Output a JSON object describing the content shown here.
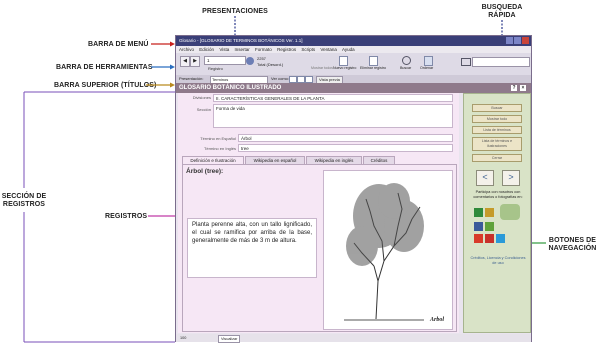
{
  "annotations": {
    "presentaciones": "PRESENTACIONES",
    "busqueda_line1": "BUSQUEDA",
    "busqueda_line2": "RÁPIDA",
    "barra_menu": "BARRA DE MENÚ",
    "barra_herramientas": "BARRA DE HERRAMIENTAS",
    "barra_superior": "BARRA SUPERIOR (TÍTULOS)",
    "seccion_line1": "SECCIÓN DE",
    "seccion_line2": "REGISTROS",
    "registros": "REGISTROS",
    "botones_line1": "BOTONES DE",
    "botones_line2": "NAVEGACIÓN"
  },
  "window": {
    "title": "Glosario - [GLOSARIO DE TERMINOS BOTÁNICOS Ver. 1.1]",
    "menu": [
      "Archivo",
      "Edición",
      "Vista",
      "Insertar",
      "Formato",
      "Registros",
      "Scripts",
      "Ventana",
      "Ayuda"
    ],
    "toolbar": {
      "record_number": "1",
      "records_total": "2257",
      "total_label": "Total (Desord.)",
      "registro_label": "Registro",
      "buttons": [
        "Mostrar todos",
        "Nuevo registro",
        "Eliminar registro",
        "Buscar",
        "Ordenar"
      ]
    },
    "toolbar2": {
      "presentacion_label": "Presentación:",
      "presentacion_value": "Terminos",
      "ver_como": "Ver como:",
      "vista_previa": "Vista previa"
    },
    "section_title": "GLOSARIO BOTÁNICO ILUSTRADO",
    "fields": {
      "divisiones_label": "Divisiones",
      "divisiones_value": "II. CARACTERÍSTICAS GENERALES DE LA PLANTA",
      "seccion_label": "Sección",
      "seccion_value": "Forma de vida",
      "termino_es_label": "Término en Español",
      "termino_es_value": "Árbol",
      "termino_en_label": "Término en Inglés",
      "termino_en_value": "tree"
    },
    "tabs": [
      "Definición e Ilustración",
      "Wikipedia en español",
      "Wikipedia en inglés",
      "Créditos"
    ],
    "record_title": "Árbol (tree):",
    "definition": "Planta perenne alta, con un tallo lignificado, el cual se ramifica por arriba de la base, generalmente de más de 3 m de altura.",
    "illustration_label": "Arbol",
    "nav": {
      "buttons": [
        "Buscar",
        "Mostrar todo",
        "Lista de términos",
        "Lista de términos e ilustraciones",
        "Cerrar"
      ],
      "prev": "<",
      "next": ">",
      "participa": "Participa con nosotros con comentarios o fotografías en:",
      "creditos": "Créditos, Licencia y Condiciones de uso"
    },
    "status": {
      "zoom": "100",
      "mode": "Visualizar"
    }
  }
}
